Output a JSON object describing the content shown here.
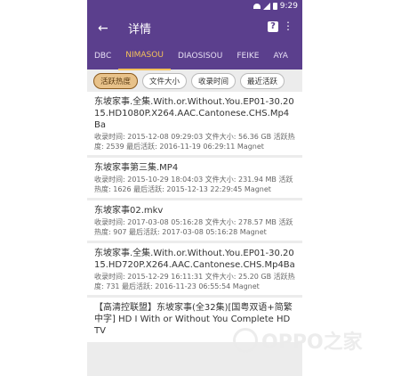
{
  "status": {
    "time": "9:29"
  },
  "appbar": {
    "title": "详情",
    "back_icon": "arrow-left-icon",
    "help_icon": "help-icon",
    "more_icon": "more-vert-icon"
  },
  "tabs": [
    {
      "label": "DBC",
      "active": false
    },
    {
      "label": "NIMASOU",
      "active": true
    },
    {
      "label": "DIAOSISOU",
      "active": false
    },
    {
      "label": "FEIKE",
      "active": false
    },
    {
      "label": "AYA",
      "active": false
    }
  ],
  "sort_chips": [
    "活跃热度",
    "文件大小",
    "收录时间",
    "最近活跃"
  ],
  "results": [
    {
      "title": "东坡家事.全集.With.or.Without.You.EP01-30.2015.HD1080P.X264.AAC.Cantonese.CHS.Mp4Ba",
      "meta": "收录时间: 2015-12-08 09:29:03 文件大小: 56.36 GB 活跃热度: 2539 最后活跃: 2016-11-19 06:29:11 Magnet"
    },
    {
      "title": "东坡家事第三集.MP4",
      "meta": "收录时间: 2015-10-29 18:04:03 文件大小: 231.94 MB 活跃热度: 1626 最后活跃: 2015-12-13 22:29:45 Magnet"
    },
    {
      "title": "东坡家事02.mkv",
      "meta": "收录时间: 2017-03-08 05:16:28 文件大小: 278.57 MB 活跃热度: 907 最后活跃: 2017-03-08 05:16:28 Magnet"
    },
    {
      "title": "东坡家事.全集.With.or.Without.You.EP01-30.2015.HD720P.X264.AAC.Cantonese.CHS.Mp4Ba",
      "meta": "收录时间: 2015-12-29 16:11:31 文件大小: 25.20 GB 活跃热度: 731 最后活跃: 2016-11-23 06:55:54 Magnet"
    },
    {
      "title": "【高清控联盟】东坡家事(全32集)[国粤双语+简繁中字] HD I With or Without You Complete HDTV",
      "meta": ""
    }
  ],
  "watermark": {
    "text": "OPPO之家"
  }
}
